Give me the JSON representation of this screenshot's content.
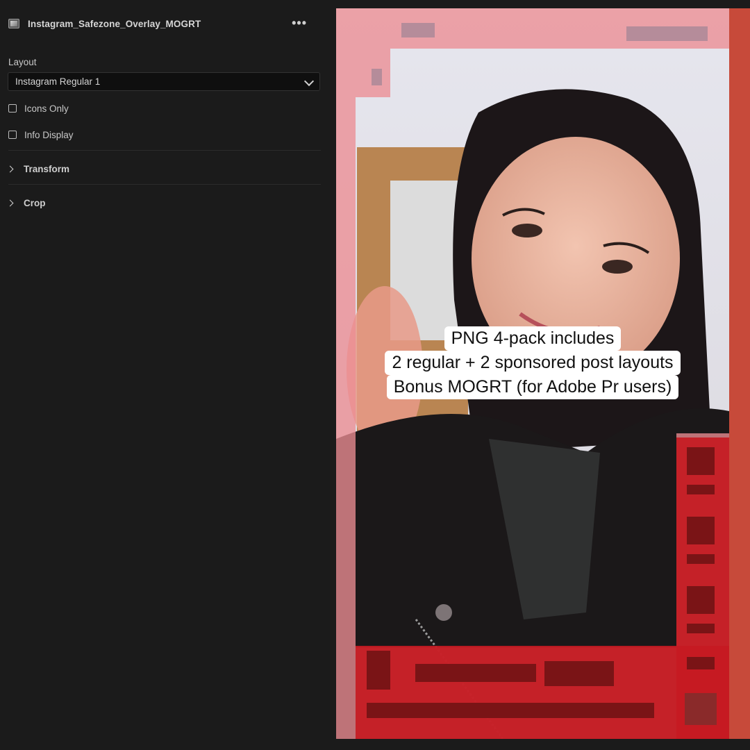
{
  "panel": {
    "title": "Instagram_Safezone_Overlay_MOGRT",
    "more_icon": "more-horizontal-icon",
    "layout_label": "Layout",
    "layout_value": "Instagram Regular 1",
    "checkboxes": [
      {
        "label": "Icons Only",
        "checked": false
      },
      {
        "label": "Info Display",
        "checked": false
      }
    ],
    "groups": [
      {
        "label": "Transform",
        "expanded": false
      },
      {
        "label": "Crop",
        "expanded": false
      }
    ]
  },
  "preview": {
    "caption_lines": [
      "PNG 4-pack includes",
      "2 regular + 2 sponsored post layouts",
      "Bonus MOGRT (for Adobe Pr users)"
    ]
  },
  "colors": {
    "panel_bg": "#1b1b1b",
    "overlay_pink": "#e99ca0",
    "overlay_red": "#c8131a",
    "caption_bg": "#ffffff"
  }
}
